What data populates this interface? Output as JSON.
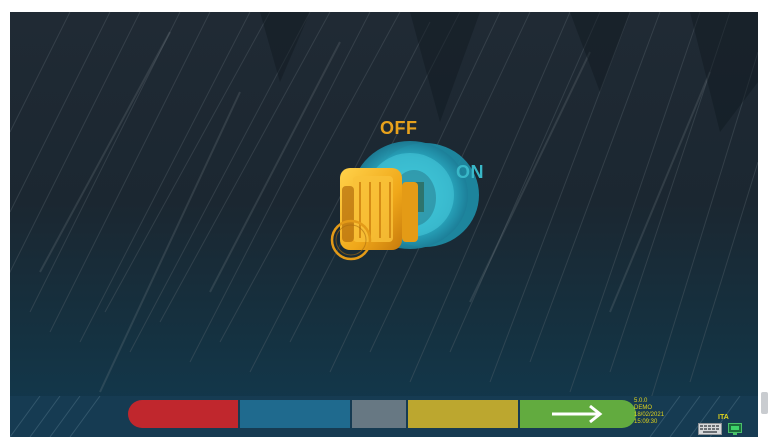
{
  "switch": {
    "off_label": "OFF",
    "on_label": "ON"
  },
  "nav": {
    "buttons": [
      {
        "name": "red",
        "color": "#c0272d"
      },
      {
        "name": "blue",
        "color": "#1f6a8e"
      },
      {
        "name": "gray",
        "color": "#677883"
      },
      {
        "name": "yellow",
        "color": "#bca72f"
      },
      {
        "name": "next",
        "color": "#62ab3f",
        "icon": "arrow-right-icon"
      }
    ]
  },
  "status": {
    "version": "5.0.0",
    "mode": "DEMO",
    "date": "18/02/2021",
    "time": "15:09:30",
    "language": "ITA"
  },
  "icons": [
    "keyboard-icon",
    "monitor-icon"
  ]
}
